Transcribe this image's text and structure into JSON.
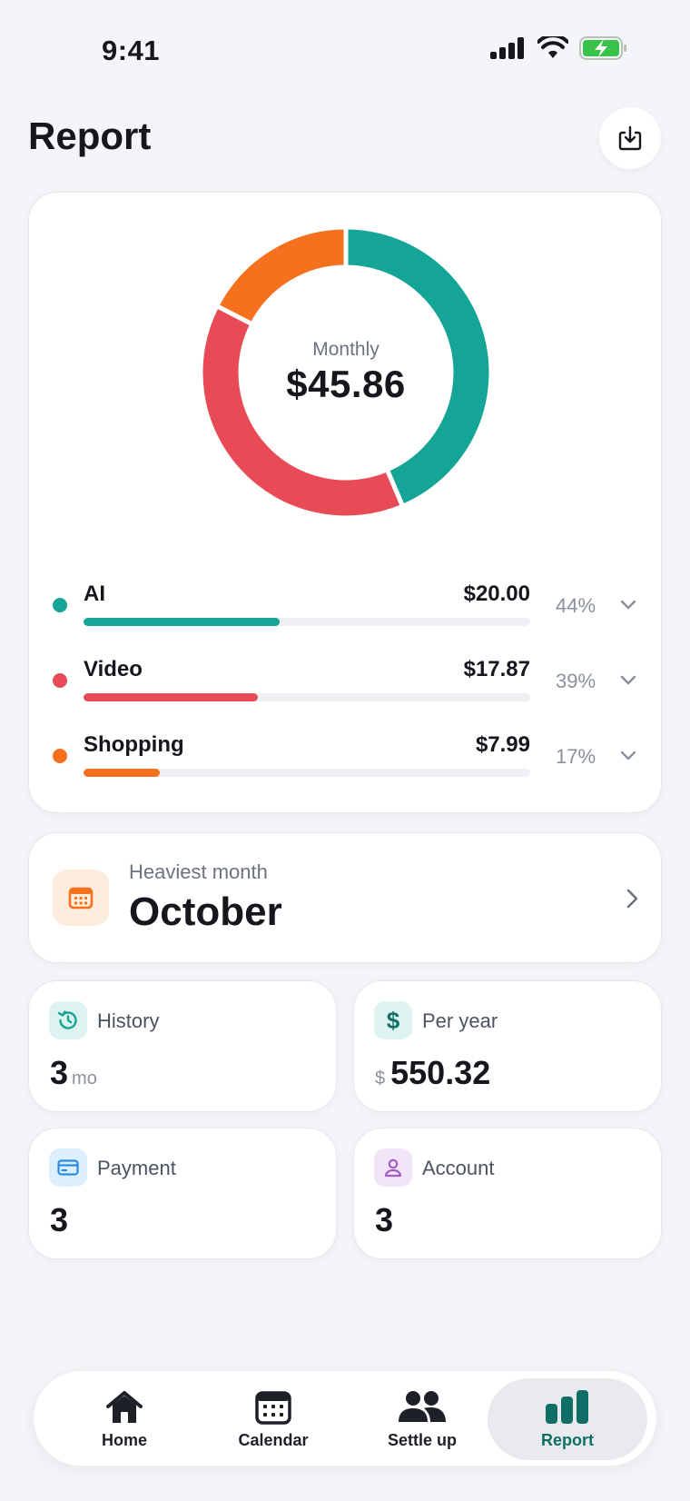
{
  "status_bar": {
    "time": "9:41"
  },
  "header": {
    "title": "Report"
  },
  "colors": {
    "ai": "#14a596",
    "video": "#e84b55",
    "shopping": "#f5711d",
    "accent": "#0f6f66"
  },
  "chart_data": {
    "type": "pie",
    "center_label": "Monthly",
    "center_value": "$45.86",
    "categories": [
      "AI",
      "Video",
      "Shopping"
    ],
    "values": [
      20.0,
      17.87,
      7.99
    ],
    "colors": [
      "#14a596",
      "#e84b55",
      "#f5711d"
    ]
  },
  "categories": [
    {
      "name": "AI",
      "amount": "$20.00",
      "percent": "44%",
      "fraction": 0.44,
      "color": "#14a596"
    },
    {
      "name": "Video",
      "amount": "$17.87",
      "percent": "39%",
      "fraction": 0.39,
      "color": "#e84b55"
    },
    {
      "name": "Shopping",
      "amount": "$7.99",
      "percent": "17%",
      "fraction": 0.17,
      "color": "#f5711d"
    }
  ],
  "heaviest": {
    "label": "Heaviest month",
    "value": "October"
  },
  "stats": {
    "history": {
      "label": "History",
      "value": "3",
      "unit": "mo"
    },
    "per_year": {
      "label": "Per year",
      "prefix": "$",
      "value": "550.32"
    },
    "payment": {
      "label": "Payment",
      "value": "3"
    },
    "account": {
      "label": "Account",
      "value": "3"
    }
  },
  "tabs": [
    {
      "label": "Home",
      "icon": "house-icon"
    },
    {
      "label": "Calendar",
      "icon": "calendar-icon"
    },
    {
      "label": "Settle up",
      "icon": "people-icon"
    },
    {
      "label": "Report",
      "icon": "bar-chart-icon",
      "active": true
    }
  ]
}
